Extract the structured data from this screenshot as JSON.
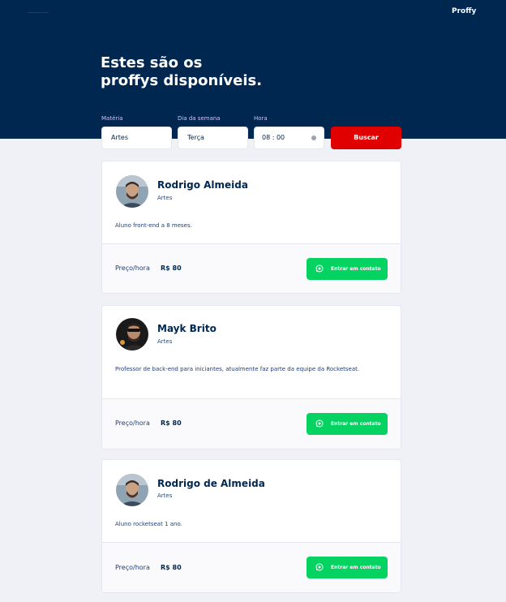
{
  "app": {
    "logo": "Proffy",
    "title_line1": "Estes são os",
    "title_line2": "proffys disponíveis.",
    "back_icon": "back-arrow-icon"
  },
  "filters": {
    "subject": {
      "label": "Matéria",
      "value": "Artes"
    },
    "weekday": {
      "label": "Dia da semana",
      "value": "Terça"
    },
    "time": {
      "label": "Hora",
      "value": "08 : 00"
    },
    "search_label": "Buscar",
    "search_color": "#E00000"
  },
  "teachers": [
    {
      "name": "Rodrigo Almeida",
      "subject": "Artes",
      "bio": "Aluno front-end a 8 meses.",
      "price_label": "Preço/hora",
      "price": "R$ 80",
      "contact_label": "Entrar em contato"
    },
    {
      "name": "Mayk Brito",
      "subject": "Artes",
      "bio": "Professor de back-end para iniciantes, atualmente faz parte da equipe da Rocketseat.",
      "price_label": "Preço/hora",
      "price": "R$ 80",
      "contact_label": "Entrar em contato"
    },
    {
      "name": "Rodrigo de Almeida",
      "subject": "Artes",
      "bio": "Aluno rocketseat 1 ano.",
      "price_label": "Preço/hora",
      "price": "R$ 80",
      "contact_label": "Entrar em contato"
    }
  ],
  "colors": {
    "header_bg": "#002750",
    "page_bg": "#F0F0F7",
    "contact_green": "#04D361"
  }
}
